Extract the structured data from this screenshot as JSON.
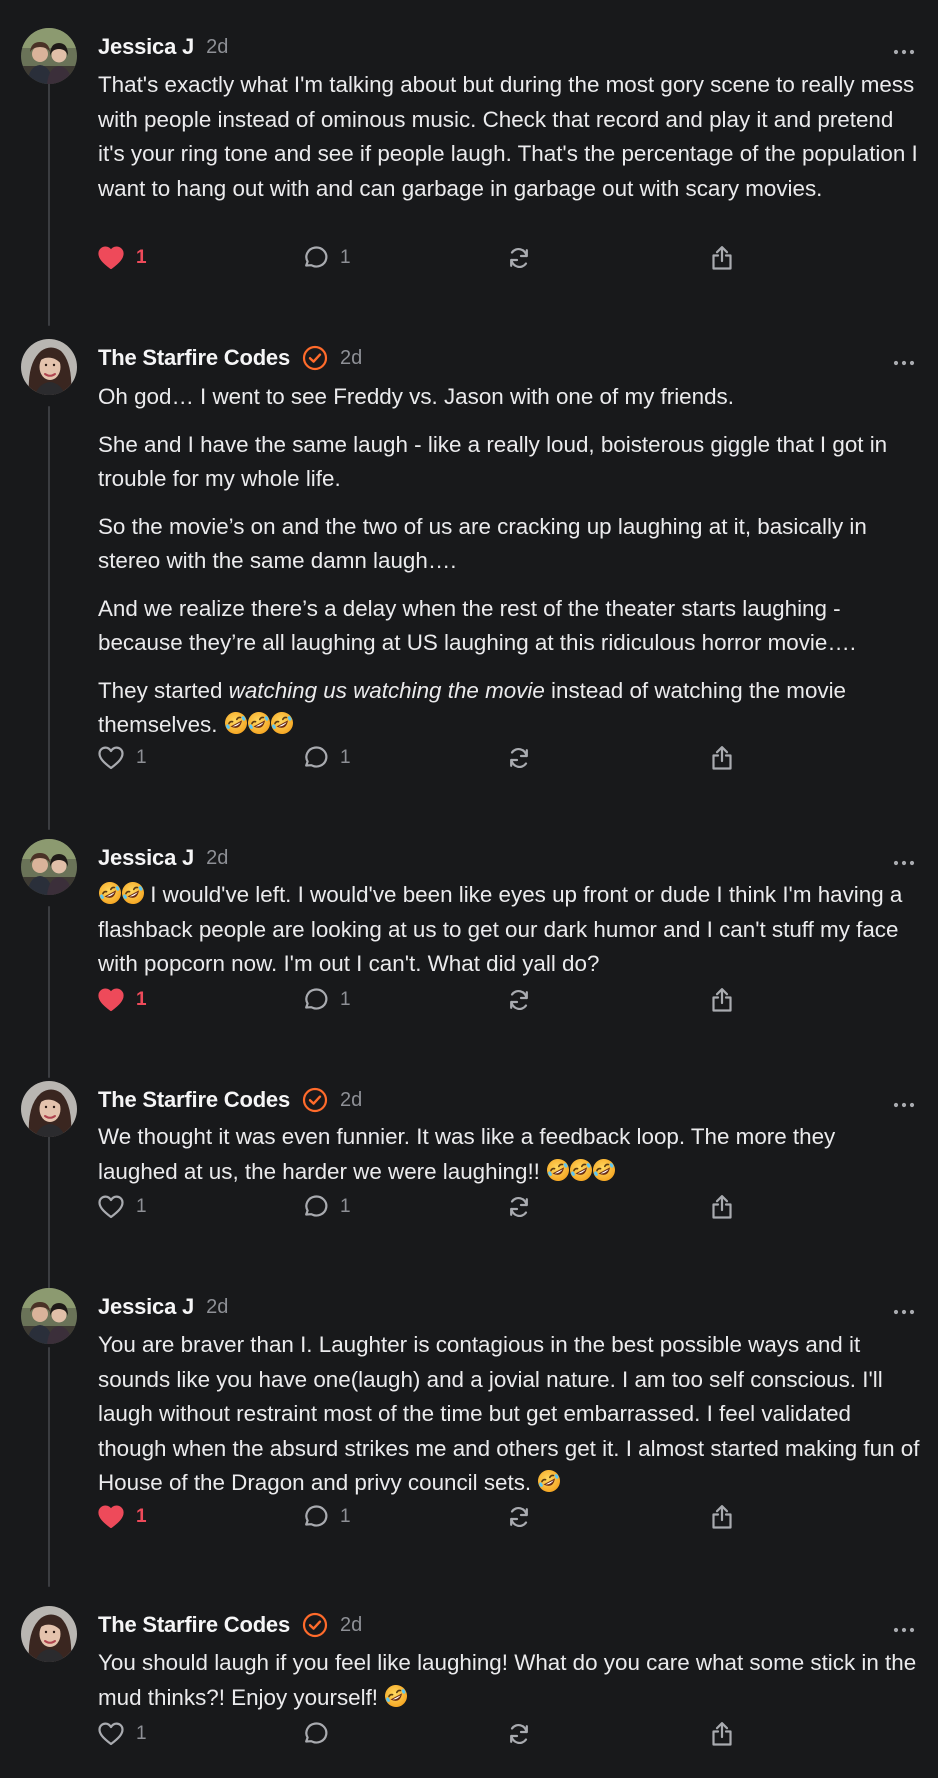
{
  "colors": {
    "background": "#18191b",
    "like_active": "#ee4a5a",
    "verified_badge": "#ff6b2b",
    "muted": "#8e9096",
    "thread_line": "#3b3d41"
  },
  "icons": {
    "like": "heart-icon",
    "reply": "speech-bubble-icon",
    "repost": "repost-arrows-icon",
    "share": "share-upload-icon",
    "more": "ellipsis-icon",
    "verified": "verified-check-icon",
    "emoji": "rolling-on-floor-laughing-emoji"
  },
  "posts": [
    {
      "author": "Jessica J",
      "verified": false,
      "time": "2d",
      "paragraphs": [
        {
          "text": "That's exactly what I'm talking about but during the most gory scene to really mess with people instead of ominous music. Check that record and play it and pretend it's your ring tone and see if people laugh. That's the percentage of the population I want to hang out with and can garbage in garbage out with scary movies."
        }
      ],
      "likes": "1",
      "liked": true,
      "replies": "1"
    },
    {
      "author": "The Starfire Codes",
      "verified": true,
      "time": "2d",
      "paragraphs": [
        {
          "text": "Oh god… I went to see Freddy vs. Jason with one of my friends."
        },
        {
          "text": "She and I have the same laugh - like a really loud, boisterous giggle that I got in trouble for my whole life."
        },
        {
          "text": "So the movie’s on and the two of us are cracking up laughing at it, basically in stereo with the same damn laugh…."
        },
        {
          "text": "And we realize there’s a delay when the rest of the theater starts laughing - because they’re all laughing at US laughing at this ridiculous horror movie…."
        },
        {
          "before": "They started ",
          "italic": "watching us watching the movie",
          "after": " instead of watching the movie themselves. ",
          "emoji_after": 3
        }
      ],
      "likes": "1",
      "liked": false,
      "replies": "1"
    },
    {
      "author": "Jessica J",
      "verified": false,
      "time": "2d",
      "paragraphs": [
        {
          "emoji_before": 2,
          "text": " I would've left. I would've been like eyes up front or dude I think I'm having a flashback people are looking at us to get our dark humor and I can't stuff my face with popcorn now. I'm out I can't. What did yall do?"
        }
      ],
      "likes": "1",
      "liked": true,
      "replies": "1"
    },
    {
      "author": "The Starfire Codes",
      "verified": true,
      "time": "2d",
      "paragraphs": [
        {
          "text": "We thought it was even funnier. It was like a feedback loop. The more they laughed at us, the harder we were laughing!! ",
          "emoji_after": 3
        }
      ],
      "likes": "1",
      "liked": false,
      "replies": "1"
    },
    {
      "author": "Jessica J",
      "verified": false,
      "time": "2d",
      "paragraphs": [
        {
          "text": "You are braver than I. Laughter is contagious in the best possible ways and it sounds like you have one(laugh) and a jovial nature. I am too self conscious. I'll laugh without restraint most of the time but get embarrassed. I feel validated though when the absurd strikes me and others get it. I almost started making fun of House of the Dragon and privy council sets. ",
          "emoji_after": 1
        }
      ],
      "likes": "1",
      "liked": true,
      "replies": "1"
    },
    {
      "author": "The Starfire Codes",
      "verified": true,
      "time": "2d",
      "paragraphs": [
        {
          "text": "You should laugh if you feel like laughing! What do you care what some stick in the mud thinks?! Enjoy yourself! ",
          "emoji_after": 1
        }
      ],
      "likes": "1",
      "liked": false,
      "replies": ""
    }
  ]
}
